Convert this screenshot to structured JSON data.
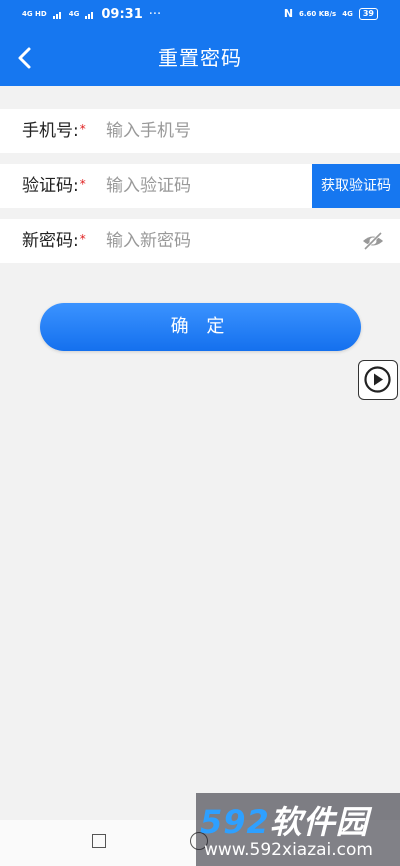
{
  "status_bar": {
    "signal_1": "4G HD",
    "signal_2": "4G",
    "time": "09:31",
    "more": "···",
    "nfc": "N",
    "speed": "6.60 KB/s",
    "signal_3": "4G",
    "battery": "39"
  },
  "header": {
    "title": "重置密码",
    "back_icon": "chevron-left-icon"
  },
  "form": {
    "phone": {
      "label": "手机号:",
      "required_mark": "*",
      "placeholder": "输入手机号"
    },
    "code": {
      "label": "验证码:",
      "required_mark": "*",
      "placeholder": "输入验证码",
      "button": "获取验证码"
    },
    "password": {
      "label": "新密码:",
      "required_mark": "*",
      "placeholder": "输入新密码",
      "toggle_icon": "eye-off-icon"
    }
  },
  "confirm_button": "确 定",
  "floating": {
    "icon": "play-circle-icon"
  },
  "navbar": {
    "icons": [
      "square-icon",
      "circle-icon"
    ]
  },
  "watermark": {
    "logo_num": "592",
    "logo_text": "软件园",
    "url": "www.592xiazai.com"
  },
  "colors": {
    "primary": "#1677f0",
    "required": "#e02020",
    "background": "#f2f2f2"
  }
}
